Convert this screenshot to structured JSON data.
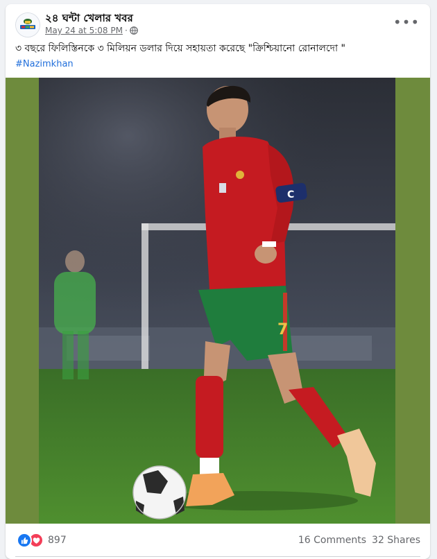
{
  "post": {
    "page_name": "২৪ ঘন্টা খেলার খবর",
    "timestamp": "May 24 at 5:08 PM",
    "separator": "·",
    "privacy_icon": "globe-icon",
    "more_icon": "more-options-icon",
    "more_label": "•••",
    "text": "৩ বছরে ফিলিস্তিনকে ৩ মিলিয়ন ডলার দিয়ে সহায়তা করেছে \"ক্রিশ্চিয়ানো রোনালদো \"",
    "hashtag": "#Nazimkhan",
    "jersey_number": "7",
    "captain_band": "C",
    "media_background": "#6e8b3d"
  },
  "reactions": {
    "icons": [
      "like-icon",
      "love-icon"
    ],
    "count": "897"
  },
  "engagement": {
    "comments": "16 Comments",
    "shares": "32 Shares"
  },
  "colors": {
    "link": "#216fdb",
    "like": "#1877f2",
    "love": "#f33e58",
    "secondary_text": "#65676b"
  }
}
